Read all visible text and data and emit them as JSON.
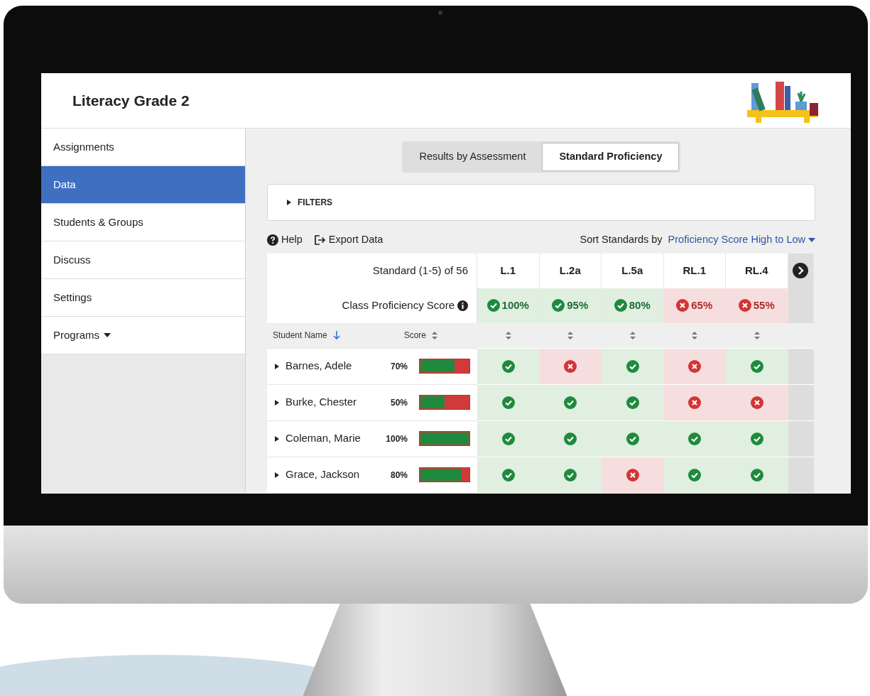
{
  "app": {
    "title": "Literacy Grade 2"
  },
  "sidebar": {
    "items": [
      {
        "label": "Assignments",
        "selected": false,
        "kind": "link"
      },
      {
        "label": "Data",
        "selected": true,
        "kind": "link"
      },
      {
        "label": "Students & Groups",
        "selected": false,
        "kind": "link"
      },
      {
        "label": "Discuss",
        "selected": false,
        "kind": "link"
      },
      {
        "label": "Settings",
        "selected": false,
        "kind": "link"
      },
      {
        "label": "Programs",
        "selected": false,
        "kind": "dropdown"
      }
    ]
  },
  "view_tabs": [
    {
      "label": "Results by Assessment",
      "selected": false
    },
    {
      "label": "Standard Proficiency",
      "selected": true
    }
  ],
  "filters": {
    "label": "FILTERS",
    "expanded": false
  },
  "toolbar": {
    "help": "Help",
    "export": "Export Data",
    "sort_label": "Sort Standards by",
    "sort_value": "Proficiency Score High to Low"
  },
  "table": {
    "standard_range": "Standard (1-5) of 56",
    "class_label": "Class Proficiency Score",
    "name_column": {
      "label": "Student Name",
      "sorted": true
    },
    "score_column": {
      "label": "Score",
      "sorted": false
    },
    "standards": [
      {
        "code": "L.1",
        "class_score": "100%",
        "proficient": true
      },
      {
        "code": "L.2a",
        "class_score": "95%",
        "proficient": true
      },
      {
        "code": "L.5a",
        "class_score": "80%",
        "proficient": true
      },
      {
        "code": "RL.1",
        "class_score": "65%",
        "proficient": false
      },
      {
        "code": "RL.4",
        "class_score": "55%",
        "proficient": false
      }
    ],
    "rows": [
      {
        "name": "Barnes, Adele",
        "score": "70%",
        "level": 0.7,
        "expanded": false,
        "results": [
          {
            "passed": true
          },
          {
            "passed": false
          },
          {
            "passed": true
          },
          {
            "passed": false
          },
          {
            "passed": true
          }
        ]
      },
      {
        "name": "Burke, Chester",
        "score": "50%",
        "level": 0.5,
        "expanded": false,
        "results": [
          {
            "passed": true
          },
          {
            "passed": true
          },
          {
            "passed": true
          },
          {
            "passed": false
          },
          {
            "passed": false
          }
        ]
      },
      {
        "name": "Coleman, Marie",
        "score": "100%",
        "level": 1.0,
        "expanded": false,
        "results": [
          {
            "passed": true
          },
          {
            "passed": true
          },
          {
            "passed": true
          },
          {
            "passed": true
          },
          {
            "passed": true
          }
        ]
      },
      {
        "name": "Grace, Jackson",
        "score": "80%",
        "level": 0.85,
        "expanded": false,
        "results": [
          {
            "passed": true
          },
          {
            "passed": true
          },
          {
            "passed": false
          },
          {
            "passed": true
          },
          {
            "passed": true
          }
        ]
      }
    ]
  }
}
